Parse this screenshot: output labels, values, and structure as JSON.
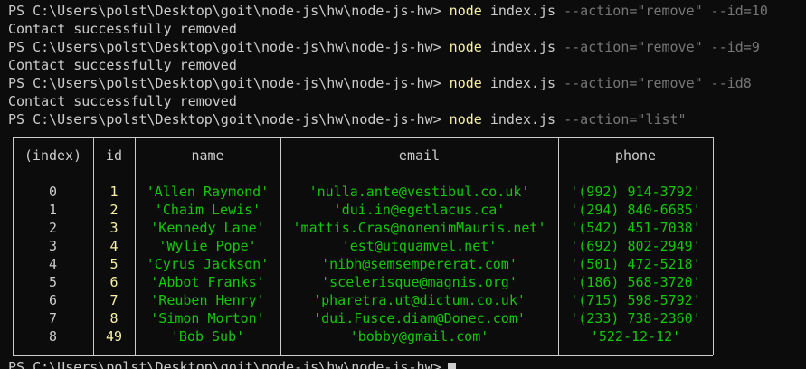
{
  "terminal": {
    "commands": [
      {
        "prompt": "PS C:\\Users\\polst\\Desktop\\goit\\node-js\\hw\\node-js-hw>",
        "cmd": "node",
        "arg": "index.js",
        "flags": "--action=\"remove\" --id=10",
        "output": "Contact successfully removed"
      },
      {
        "prompt": "PS C:\\Users\\polst\\Desktop\\goit\\node-js\\hw\\node-js-hw>",
        "cmd": "node",
        "arg": "index.js",
        "flags": "--action=\"remove\" --id=9",
        "output": "Contact successfully removed"
      },
      {
        "prompt": "PS C:\\Users\\polst\\Desktop\\goit\\node-js\\hw\\node-js-hw>",
        "cmd": "node",
        "arg": "index.js",
        "flags": "--action=\"remove\" --id8",
        "output": "Contact successfully removed"
      },
      {
        "prompt": "PS C:\\Users\\polst\\Desktop\\goit\\node-js\\hw\\node-js-hw>",
        "cmd": "node",
        "arg": "index.js",
        "flags": "--action=\"list\"",
        "output": ""
      }
    ],
    "last_prompt": "PS C:\\Users\\polst\\Desktop\\goit\\node-js\\hw\\node-js-hw>",
    "colors": {
      "background": "#0c0c0c",
      "text": "#cccccc",
      "command": "#f9f1a5",
      "flag": "#767676",
      "string": "#16c60c",
      "number": "#f9f1a5"
    }
  },
  "table": {
    "headers": [
      "(index)",
      "id",
      "name",
      "email",
      "phone"
    ],
    "rows": [
      {
        "index": "0",
        "id": "1",
        "name": "'Allen Raymond'",
        "email": "'nulla.ante@vestibul.co.uk'",
        "phone": "'(992) 914-3792'"
      },
      {
        "index": "1",
        "id": "2",
        "name": "'Chaim Lewis'",
        "email": "'dui.in@egetlacus.ca'",
        "phone": "'(294) 840-6685'"
      },
      {
        "index": "2",
        "id": "3",
        "name": "'Kennedy Lane'",
        "email": "'mattis.Cras@nonenimMauris.net'",
        "phone": "'(542) 451-7038'"
      },
      {
        "index": "3",
        "id": "4",
        "name": "'Wylie Pope'",
        "email": "'est@utquamvel.net'",
        "phone": "'(692) 802-2949'"
      },
      {
        "index": "4",
        "id": "5",
        "name": "'Cyrus Jackson'",
        "email": "'nibh@semsempererat.com'",
        "phone": "'(501) 472-5218'"
      },
      {
        "index": "5",
        "id": "6",
        "name": "'Abbot Franks'",
        "email": "'scelerisque@magnis.org'",
        "phone": "'(186) 568-3720'"
      },
      {
        "index": "6",
        "id": "7",
        "name": "'Reuben Henry'",
        "email": "'pharetra.ut@dictum.co.uk'",
        "phone": "'(715) 598-5792'"
      },
      {
        "index": "7",
        "id": "8",
        "name": "'Simon Morton'",
        "email": "'dui.Fusce.diam@Donec.com'",
        "phone": "'(233) 738-2360'"
      },
      {
        "index": "8",
        "id": "49",
        "name": "'Bob Sub'",
        "email": "'bobby@gmail.com'",
        "phone": "'522-12-12'"
      }
    ]
  }
}
